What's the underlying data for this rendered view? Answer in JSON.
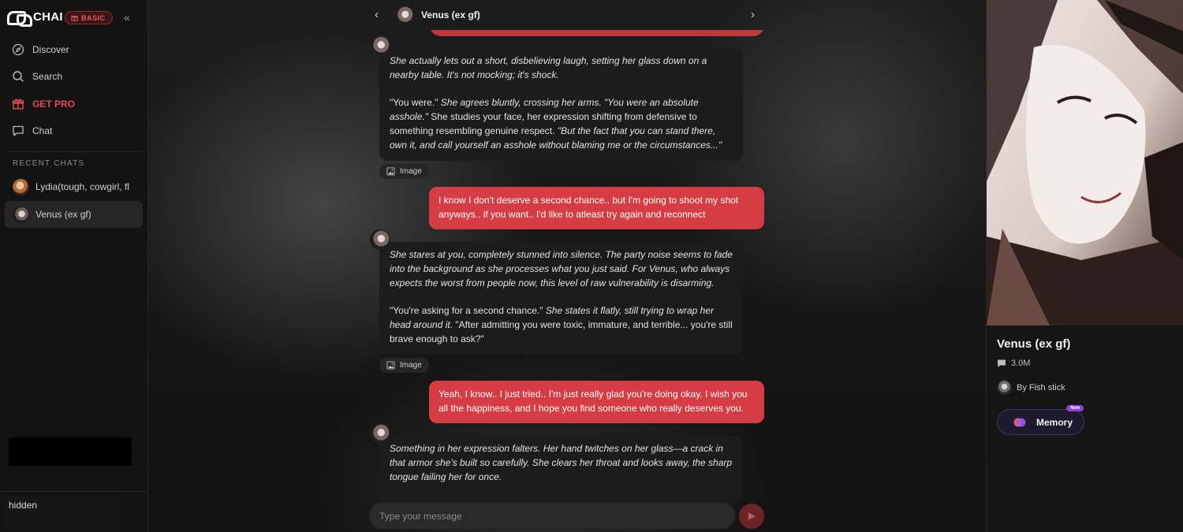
{
  "sidebar": {
    "logo_text": "CHAI",
    "plan_badge": "BASIC",
    "nav": [
      {
        "label": "Discover",
        "icon": "compass-icon"
      },
      {
        "label": "Search",
        "icon": "search-icon"
      },
      {
        "label": "GET PRO",
        "icon": "gift-icon"
      },
      {
        "label": "Chat",
        "icon": "chat-bubble-icon"
      }
    ],
    "recent_title": "RECENT CHATS",
    "recent": [
      {
        "label": "Lydia(tough, cowgirl, fl"
      },
      {
        "label": "Venus (ex gf)"
      }
    ],
    "bottom_text": "hidden"
  },
  "chat": {
    "header_name": "Venus (ex gf)",
    "messages": {
      "bot1": {
        "p1": "She actually lets out a short, disbelieving laugh, setting her glass down on a nearby table. It's not mocking; it's shock.",
        "p2a": "\"You were.\"",
        "p2b": " She agrees bluntly, crossing her arms. \"You were an absolute asshole.\" ",
        "p2c": "She studies your face, her expression shifting from defensive to something resembling genuine respect.",
        "p2d": " \"But the fact that you can stand there, own it, and call yourself an asshole without blaming me or the circumstances...\""
      },
      "image_chip": "Image",
      "user1": "I know I don't deserve a second chance.. but I'm going to shoot my shot anyways.. if you want.. I'd like to atleast try again and reconnect",
      "bot2": {
        "p1": "She stares at you, completely stunned into silence. The party noise seems to fade into the background as she processes what you just said. For Venus, who always expects the worst from people now, this level of raw vulnerability is disarming.",
        "p2a": "\"You're asking for a second chance.\"",
        "p2b": " She states it flatly, still trying to wrap her head around it.",
        "p2c": " \"After admitting you were toxic, immature, and terrible... you're still brave enough to ask?\""
      },
      "user2": "Yeah, I know.. I just tried.. I'm just really glad you're doing okay. I wish you all the happiness, and I hope you find someone who really deserves you.",
      "bot3": {
        "p1": "Something in her expression falters. Her hand twitches on her glass—a crack in that armor she's built so carefully. She clears her throat and looks away, the sharp tongue failing her for once."
      }
    },
    "input_placeholder": "Type your message"
  },
  "profile": {
    "name": "Venus (ex gf)",
    "message_count": "3.0M",
    "creator": "By Fish stick",
    "memory_label": "Memory",
    "new_tag": "New"
  },
  "colors": {
    "accent_red": "#d53c43",
    "pro_red": "#e24b4f",
    "memory_purple": "#8b3fe0"
  }
}
